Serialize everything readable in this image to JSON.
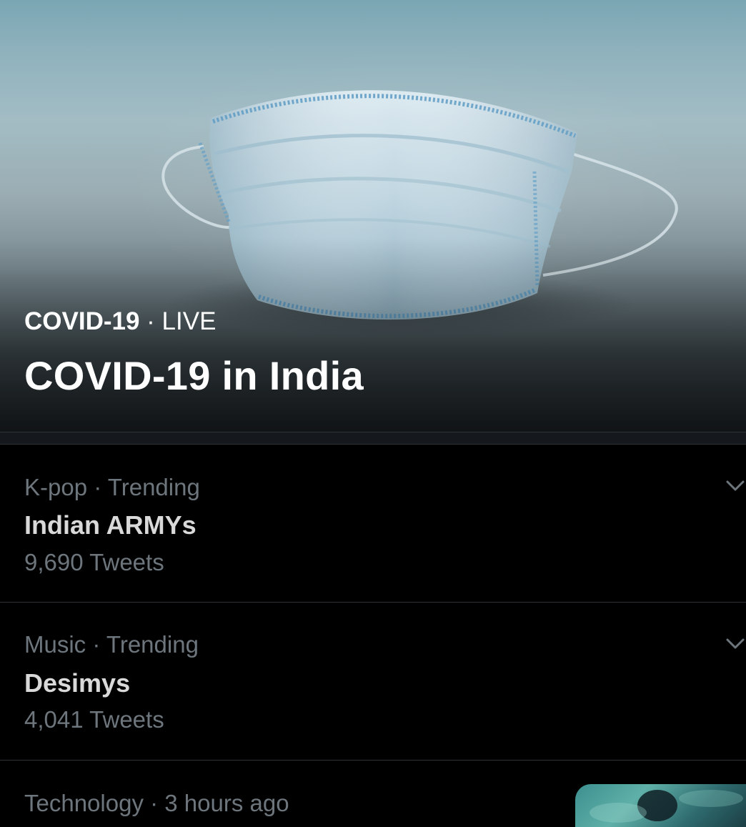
{
  "hero": {
    "category": "COVID-19",
    "separator": " · ",
    "status": "LIVE",
    "title": "COVID-19 in India"
  },
  "trends": [
    {
      "meta": "K-pop · Trending",
      "name": "Indian ARMYs",
      "count": "9,690 Tweets",
      "has_menu": true
    },
    {
      "meta": "Music · Trending",
      "name": "Desimys",
      "count": "4,041 Tweets",
      "has_menu": true
    },
    {
      "meta": "Technology · 3 hours ago",
      "has_thumbnail": true
    }
  ],
  "colors": {
    "background": "#000000",
    "primary_text": "#d9d9d9",
    "secondary_text": "#6e767d",
    "divider": "#2f3336"
  },
  "icons": {
    "menu": "chevron-down-icon"
  }
}
